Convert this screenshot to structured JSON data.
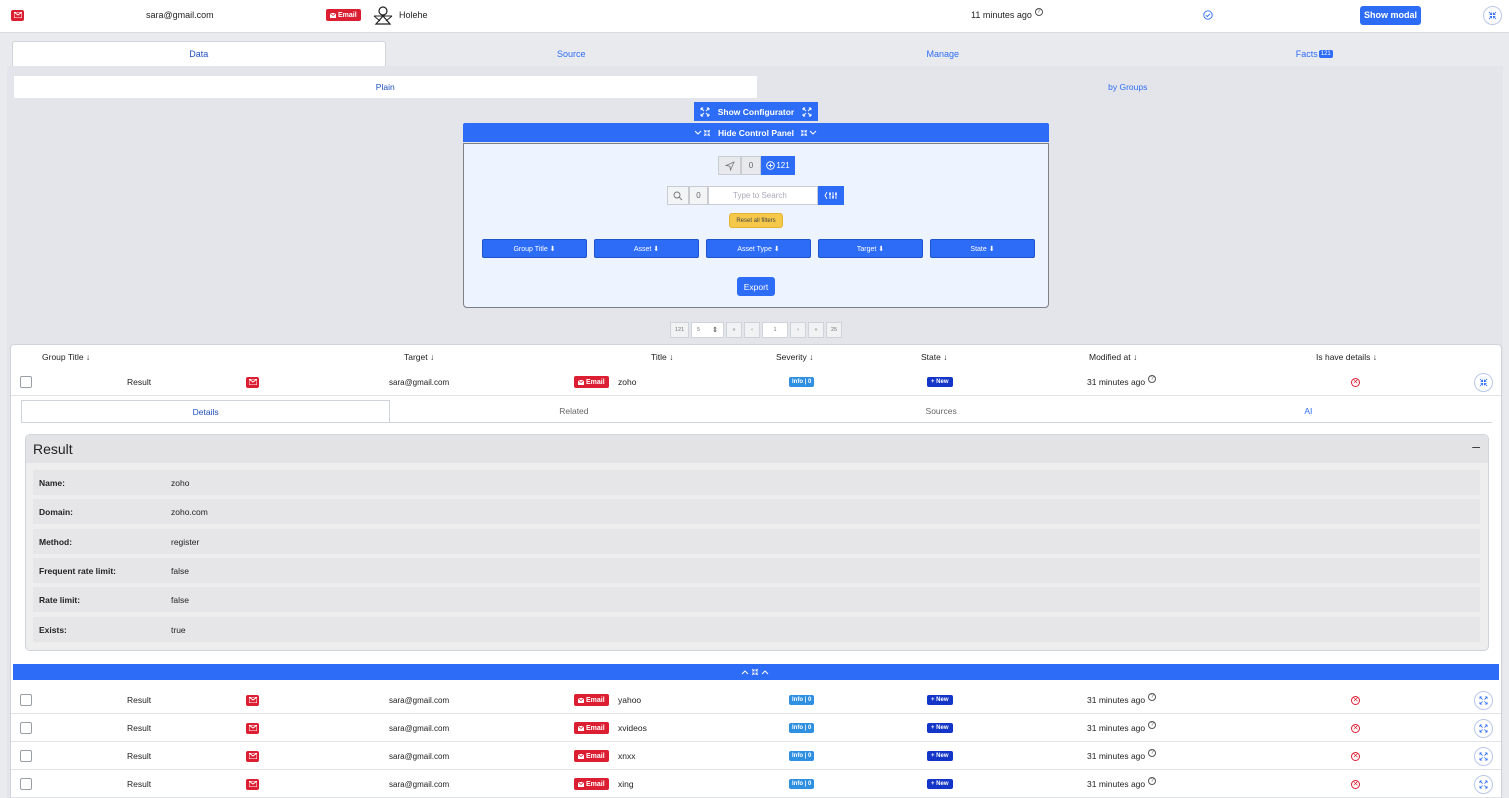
{
  "top_bar": {
    "email": "sara@gmail.com",
    "email_badge": "Email",
    "name": "Holehe",
    "time": "11 minutes ago",
    "help": "?",
    "show_modal": "Show modal"
  },
  "main_tabs": [
    {
      "label": "Data"
    },
    {
      "label": "Source"
    },
    {
      "label": "Manage"
    },
    {
      "label": "Facts",
      "count": "121"
    }
  ],
  "sub_tabs": [
    {
      "label": "Plain"
    },
    {
      "label": "by Groups"
    }
  ],
  "configurator": {
    "label": "Show Configurator"
  },
  "control_panel": {
    "label": "Hide Control Panel",
    "nav_zero": "0",
    "nav_count": "121",
    "search_count": "0",
    "search_placeholder": "Type to Search",
    "reset_label": "Reset all filters",
    "filters": [
      "Group Title ⬇",
      "Asset ⬇",
      "Asset Type ⬇",
      "Target ⬇",
      "State ⬇"
    ],
    "export_label": "Export"
  },
  "pagination": {
    "total": "121",
    "page_size": "5",
    "first": "«",
    "prev": "‹",
    "page": "1",
    "next": "›",
    "last": "»",
    "pages": "25"
  },
  "table": {
    "headers": [
      "Group Title ↓",
      "Target ↓",
      "Title ↓",
      "Severity ↓",
      "State ↓",
      "Modified at ↓",
      "Is have details ↓"
    ],
    "rows": [
      {
        "group": "Result",
        "target": "sara@gmail.com",
        "badge": "Email",
        "title": "zoho",
        "severity": "Info | 0",
        "state": "+ New",
        "modified": "31 minutes ago",
        "help": "?",
        "details": "✕"
      },
      {
        "group": "Result",
        "target": "sara@gmail.com",
        "badge": "Email",
        "title": "yahoo",
        "severity": "Info | 0",
        "state": "+ New",
        "modified": "31 minutes ago",
        "help": "?",
        "details": "✕"
      },
      {
        "group": "Result",
        "target": "sara@gmail.com",
        "badge": "Email",
        "title": "xvideos",
        "severity": "Info | 0",
        "state": "+ New",
        "modified": "31 minutes ago",
        "help": "?",
        "details": "✕"
      },
      {
        "group": "Result",
        "target": "sara@gmail.com",
        "badge": "Email",
        "title": "xnxx",
        "severity": "Info | 0",
        "state": "+ New",
        "modified": "31 minutes ago",
        "help": "?",
        "details": "✕"
      },
      {
        "group": "Result",
        "target": "sara@gmail.com",
        "badge": "Email",
        "title": "xing",
        "severity": "Info | 0",
        "state": "+ New",
        "modified": "31 minutes ago",
        "help": "?",
        "details": "✕"
      }
    ]
  },
  "detail": {
    "tabs": [
      "Details",
      "Related",
      "Sources",
      "AI"
    ],
    "card_title": "Result",
    "card_toggle": "–",
    "fields": [
      {
        "key": "Name:",
        "value": "zoho"
      },
      {
        "key": "Domain:",
        "value": "zoho.com"
      },
      {
        "key": "Method:",
        "value": "register"
      },
      {
        "key": "Frequent rate limit:",
        "value": "false"
      },
      {
        "key": "Rate limit:",
        "value": "false"
      },
      {
        "key": "Exists:",
        "value": "true"
      }
    ]
  },
  "icons": {
    "mail": "mail-icon",
    "person": "person-icon",
    "check": "check-circle-icon",
    "collapse": "collapse-arrows-icon",
    "send": "send-icon",
    "plus_circle": "plus-circle-icon",
    "search": "search-icon",
    "sliders": "sliders-icon",
    "x_circle": "x-circle-icon"
  },
  "colors": {
    "accent": "#2d6cf6",
    "danger": "#dc1e32",
    "warning": "#f6c84a",
    "state": "#1436c8",
    "info": "#2f8fe0"
  }
}
